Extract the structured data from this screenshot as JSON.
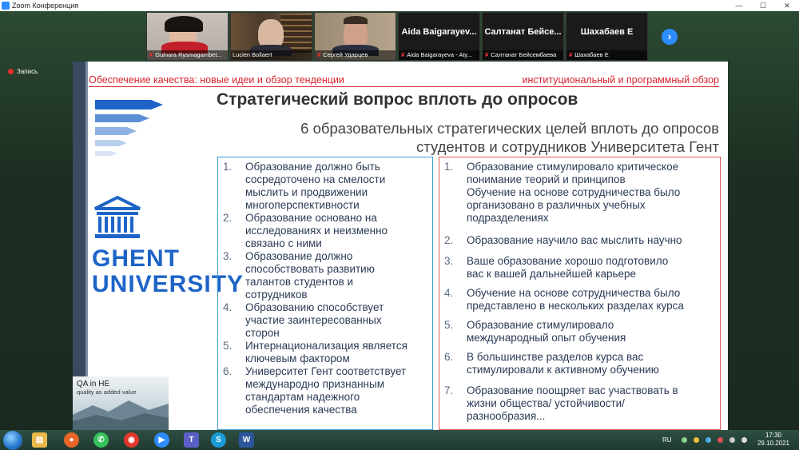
{
  "window": {
    "title": "Zoom Конференция",
    "controls": [
      "—",
      "☐",
      "✕"
    ]
  },
  "recording": {
    "label": "Запись"
  },
  "participants": [
    {
      "name": "Gulnara Rysmagambet...",
      "type": "video"
    },
    {
      "name": "Lucien Bollaert",
      "type": "video"
    },
    {
      "name": "Сергей Ударцев",
      "type": "video"
    },
    {
      "name": "Aida Baigarayeva - Aty...",
      "display": "Aida Baigarayev...",
      "type": "name"
    },
    {
      "name": "Салтанат Бейсембаева",
      "display": "Салтанат Бейсе...",
      "type": "name"
    },
    {
      "name": "Шахабаев Е",
      "display": "Шахабаев Е",
      "type": "name"
    }
  ],
  "next_button": "›",
  "slide": {
    "header_left": "Обеспечение качества: новые идеи и обзор тенденции",
    "header_right": "институциональный и программный обзор",
    "title": "Стратегический вопрос вплоть до опросов",
    "subtitle_line1": "6 образовательных стратегических целей вплоть до опросов",
    "subtitle_line2": "студентов и сотрудников Университета Гент",
    "logo_line1": "GHENT",
    "logo_line2": "UNIVERSITY",
    "qa_title": "QA in HE",
    "qa_subtitle": "quality as added value",
    "left_list": [
      {
        "num": "1.",
        "lines": [
          "Образование должно быть",
          "сосредоточено на смелости",
          "мыслить и продвижении",
          "многоперспективности"
        ]
      },
      {
        "num": "2.",
        "lines": [
          "Образование основано на",
          "исследованиях и неизменно",
          "связано с ними"
        ]
      },
      {
        "num": "3.",
        "lines": [
          "Образование должно",
          "способствовать развитию",
          "талантов студентов и",
          "сотрудников"
        ]
      },
      {
        "num": "4.",
        "lines": [
          "Образованию способствует",
          "участие заинтересованных",
          "сторон"
        ]
      },
      {
        "num": "5.",
        "lines": [
          "Интернационализация является",
          "ключевым фактором"
        ]
      },
      {
        "num": "6.",
        "lines": [
          "Университет Гент соответствует",
          "международно признанным",
          "стандартам надежного",
          "обеспечения качества"
        ]
      }
    ],
    "right_list": [
      {
        "num": "1.",
        "lines": [
          "Образование стимулировало критическое",
          "понимание теорий и принципов",
          "Обучение на основе сотрудничества было",
          "организовано в различных учебных",
          "подразделениях"
        ]
      },
      {
        "num": "2.",
        "lines": [
          "Образование научило вас мыслить научно"
        ]
      },
      {
        "num": "3.",
        "lines": [
          "Ваше образование хорошо подготовило",
          "вас к вашей дальнейшей карьере"
        ]
      },
      {
        "num": "4.",
        "lines": [
          "Обучение на основе сотрудничества было",
          "представлено в нескольких разделах курса"
        ]
      },
      {
        "num": "5.",
        "lines": [
          "Образование стимулировало",
          "международный опыт обучения"
        ]
      },
      {
        "num": "6.",
        "lines": [
          "В большинстве разделов курса вас",
          "стимулировали к активному обучению"
        ]
      },
      {
        "num": "7.",
        "lines": [
          "Образование поощряет вас участвовать в",
          "жизни общества/ устойчивости/",
          "разнообразия..."
        ]
      }
    ]
  },
  "taskbar": {
    "language": "RU",
    "time": "17:30",
    "date": "29.10.2021",
    "apps": [
      "explorer-icon",
      "firefox-icon",
      "whatsapp-icon",
      "chrome-icon",
      "zoom-icon",
      "teams-icon",
      "skype-icon",
      "word-icon"
    ]
  },
  "colors": {
    "accent_red": "#d9232d",
    "ghent_blue": "#1e64c8",
    "left_border": "#3aa0d6",
    "right_border": "#e05a5a",
    "zoom_blue": "#2d8cff"
  }
}
